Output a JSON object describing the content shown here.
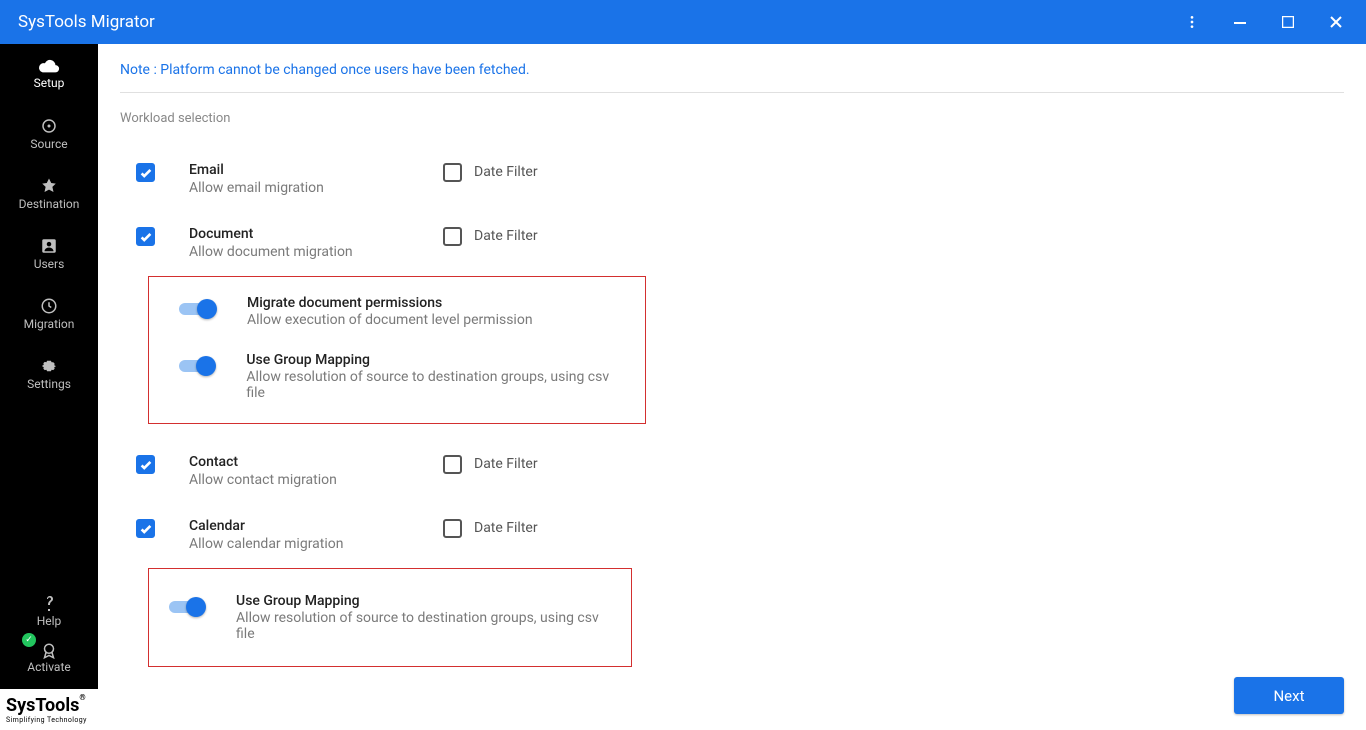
{
  "titlebar": {
    "title": "SysTools Migrator"
  },
  "sidebar": {
    "items": [
      {
        "label": "Setup"
      },
      {
        "label": "Source"
      },
      {
        "label": "Destination"
      },
      {
        "label": "Users"
      },
      {
        "label": "Migration"
      },
      {
        "label": "Settings"
      }
    ],
    "help": "Help",
    "activate": "Activate"
  },
  "brand": {
    "name": "SysTools",
    "sub": "Simplifying Technology"
  },
  "main": {
    "note": "Note : Platform cannot be changed once users have been fetched.",
    "section": "Workload selection",
    "filter_label": "Date Filter",
    "next": "Next",
    "wl": {
      "email": {
        "title": "Email",
        "sub": "Allow email migration"
      },
      "doc": {
        "title": "Document",
        "sub": "Allow document migration"
      },
      "doc_perm": {
        "title": "Migrate document permissions",
        "sub": "Allow execution of document level permission"
      },
      "doc_group": {
        "title": "Use Group Mapping",
        "sub": "Allow resolution of source to destination groups, using csv file"
      },
      "contact": {
        "title": "Contact",
        "sub": "Allow contact migration"
      },
      "calendar": {
        "title": "Calendar",
        "sub": "Allow calendar migration"
      },
      "cal_group": {
        "title": "Use Group Mapping",
        "sub": "Allow resolution of source to destination groups, using csv file"
      }
    }
  }
}
